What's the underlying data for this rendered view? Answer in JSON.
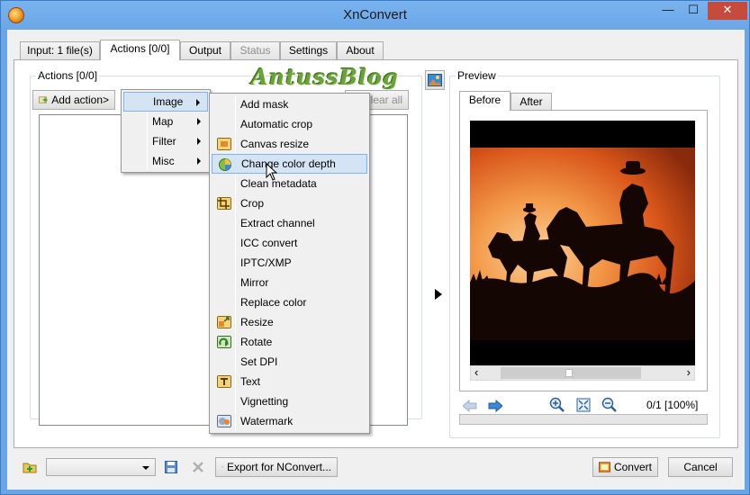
{
  "window": {
    "title": "XnConvert",
    "minimize_glyph": "—",
    "maximize_glyph": "☐",
    "close_glyph": "✕"
  },
  "tabs": [
    {
      "label": "Input: 1 file(s)",
      "state": "normal"
    },
    {
      "label": "Actions [0/0]",
      "state": "active"
    },
    {
      "label": "Output",
      "state": "normal"
    },
    {
      "label": "Status",
      "state": "disabled"
    },
    {
      "label": "Settings",
      "state": "normal"
    },
    {
      "label": "About",
      "state": "normal"
    }
  ],
  "actions_panel": {
    "group_title": "Actions [0/0]",
    "add_action_label": "Add action>",
    "clear_all_label": "Clear all"
  },
  "watermark": "AntussBlog",
  "category_menu": [
    {
      "label": "Image",
      "highlighted": true
    },
    {
      "label": "Map",
      "highlighted": false
    },
    {
      "label": "Filter",
      "highlighted": false
    },
    {
      "label": "Misc",
      "highlighted": false
    }
  ],
  "image_menu": [
    {
      "label": "Add mask",
      "icon": ""
    },
    {
      "label": "Automatic crop",
      "icon": ""
    },
    {
      "label": "Canvas resize",
      "icon": "canvas-icon"
    },
    {
      "label": "Change color depth",
      "icon": "color-depth-icon",
      "highlighted": true
    },
    {
      "label": "Clean metadata",
      "icon": ""
    },
    {
      "label": "Crop",
      "icon": "crop-icon"
    },
    {
      "label": "Extract channel",
      "icon": ""
    },
    {
      "label": "ICC convert",
      "icon": ""
    },
    {
      "label": "IPTC/XMP",
      "icon": ""
    },
    {
      "label": "Mirror",
      "icon": ""
    },
    {
      "label": "Replace color",
      "icon": ""
    },
    {
      "label": "Resize",
      "icon": "resize-icon"
    },
    {
      "label": "Rotate",
      "icon": "rotate-icon"
    },
    {
      "label": "Set DPI",
      "icon": ""
    },
    {
      "label": "Text",
      "icon": "text-icon"
    },
    {
      "label": "Vignetting",
      "icon": ""
    },
    {
      "label": "Watermark",
      "icon": "watermark-icon"
    }
  ],
  "preview": {
    "group_title": "Preview",
    "tab_before": "Before",
    "tab_after": "After",
    "zoom_status": "0/1 [100%]",
    "scroll_left": "‹",
    "scroll_right": "›"
  },
  "bottom_bar": {
    "format_value": "",
    "export_label": "Export for NConvert...",
    "convert_label": "Convert",
    "cancel_label": "Cancel"
  },
  "colors": {
    "window_frame": "#6aa5e6",
    "menu_highlight": "#d5e4f4",
    "close_button": "#c74b3c",
    "sky_orange": "#e8691f"
  }
}
